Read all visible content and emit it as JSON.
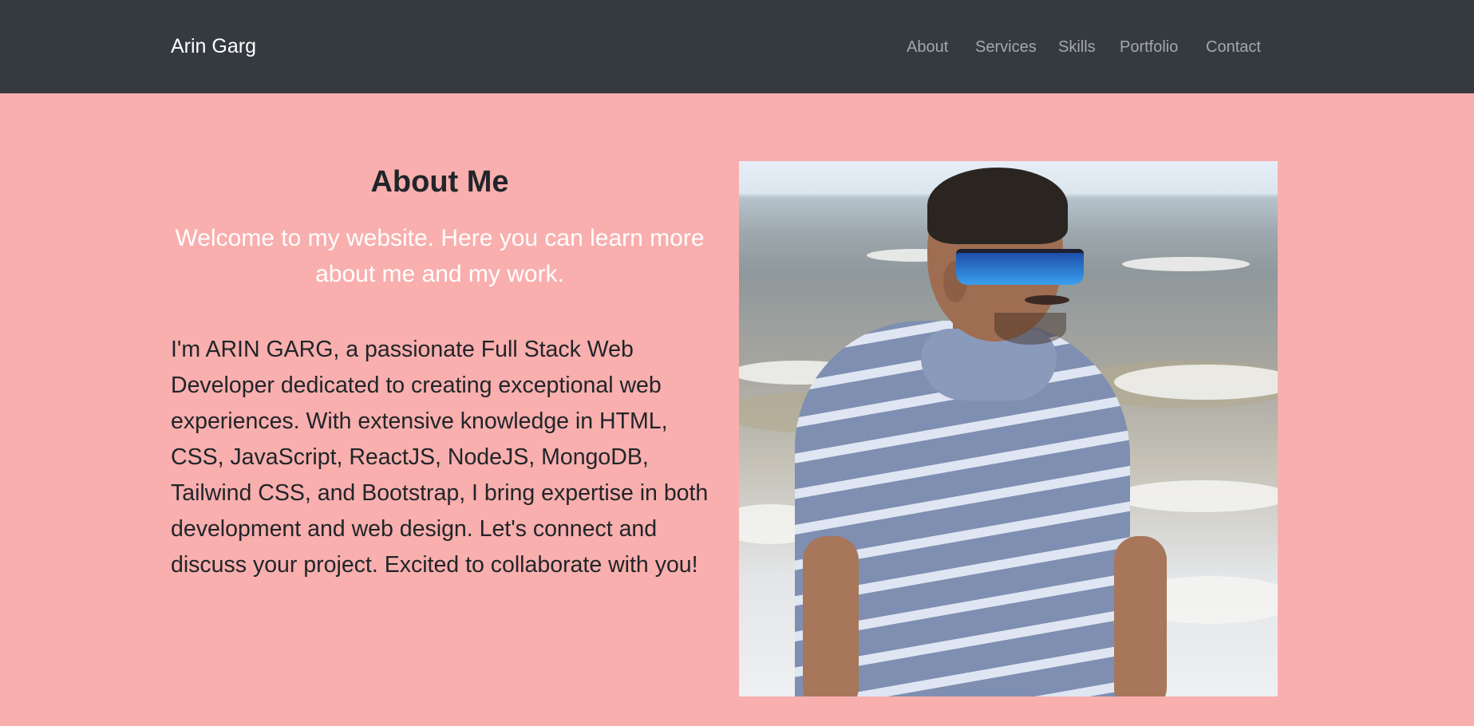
{
  "navbar": {
    "brand": "Arin Garg",
    "links": [
      "About",
      "Services",
      "Skills",
      "Portfolio",
      "Contact"
    ]
  },
  "about": {
    "title": "About Me",
    "subtitle": "Welcome to my website. Here you can learn more about me and my work.",
    "body": "I'm ARIN GARG, a passionate Full Stack Web Developer dedicated to creating exceptional web experiences. With extensive knowledge in HTML, CSS, JavaScript, ReactJS, NodeJS, MongoDB, Tailwind CSS, and Bootstrap, I bring expertise in both development and web design. Let's connect and discuss your project. Excited to collaborate with you!"
  },
  "colors": {
    "navbar_bg": "#343a40",
    "page_bg": "#f8afae",
    "nav_link": "rgba(255,255,255,0.55)"
  }
}
